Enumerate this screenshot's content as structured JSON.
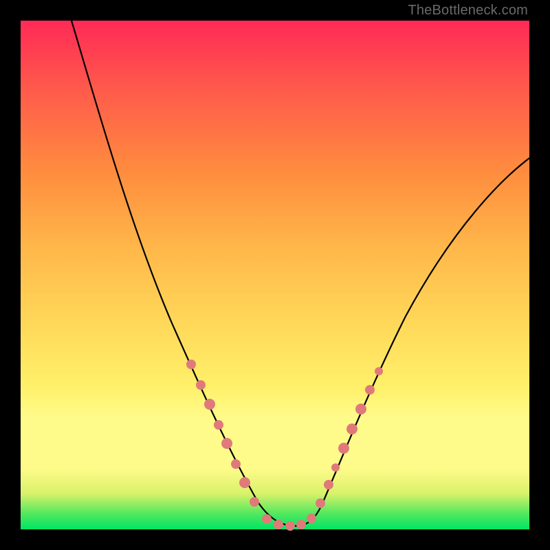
{
  "watermark": "TheBottleneck.com",
  "colors": {
    "frame": "#000000",
    "gradient_top": "#ff2a56",
    "gradient_mid": "#ffd95a",
    "gradient_bottom": "#00e566",
    "curve": "#000000",
    "bead": "#e07a7a"
  },
  "chart_data": {
    "type": "line",
    "title": "",
    "xlabel": "",
    "ylabel": "",
    "xlim": [
      0,
      100
    ],
    "ylim": [
      0,
      100
    ],
    "grid": false,
    "legend": false,
    "series": [
      {
        "name": "bottleneck-curve",
        "x": [
          10,
          14,
          18,
          22,
          26,
          30,
          34,
          38,
          40,
          42,
          44,
          46,
          48,
          50,
          52,
          54,
          56,
          58,
          60,
          64,
          68,
          72,
          76,
          80,
          84,
          88,
          92,
          96,
          100
        ],
        "y": [
          100,
          91,
          82,
          73,
          63,
          53,
          44,
          35,
          30,
          25,
          20,
          14,
          8,
          3,
          1,
          1,
          1,
          4,
          9,
          18,
          27,
          35,
          42,
          48,
          53,
          57,
          60,
          62,
          64
        ]
      }
    ],
    "annotations": {
      "beads_left_segment": {
        "x_range": [
          34,
          48
        ],
        "note": "cluster of pink beads on descending arm"
      },
      "beads_bottom_flat": {
        "x_range": [
          48,
          58
        ],
        "note": "beads along valley floor"
      },
      "beads_right_segment": {
        "x_range": [
          58,
          68
        ],
        "note": "cluster of pink beads on ascending arm"
      }
    }
  }
}
